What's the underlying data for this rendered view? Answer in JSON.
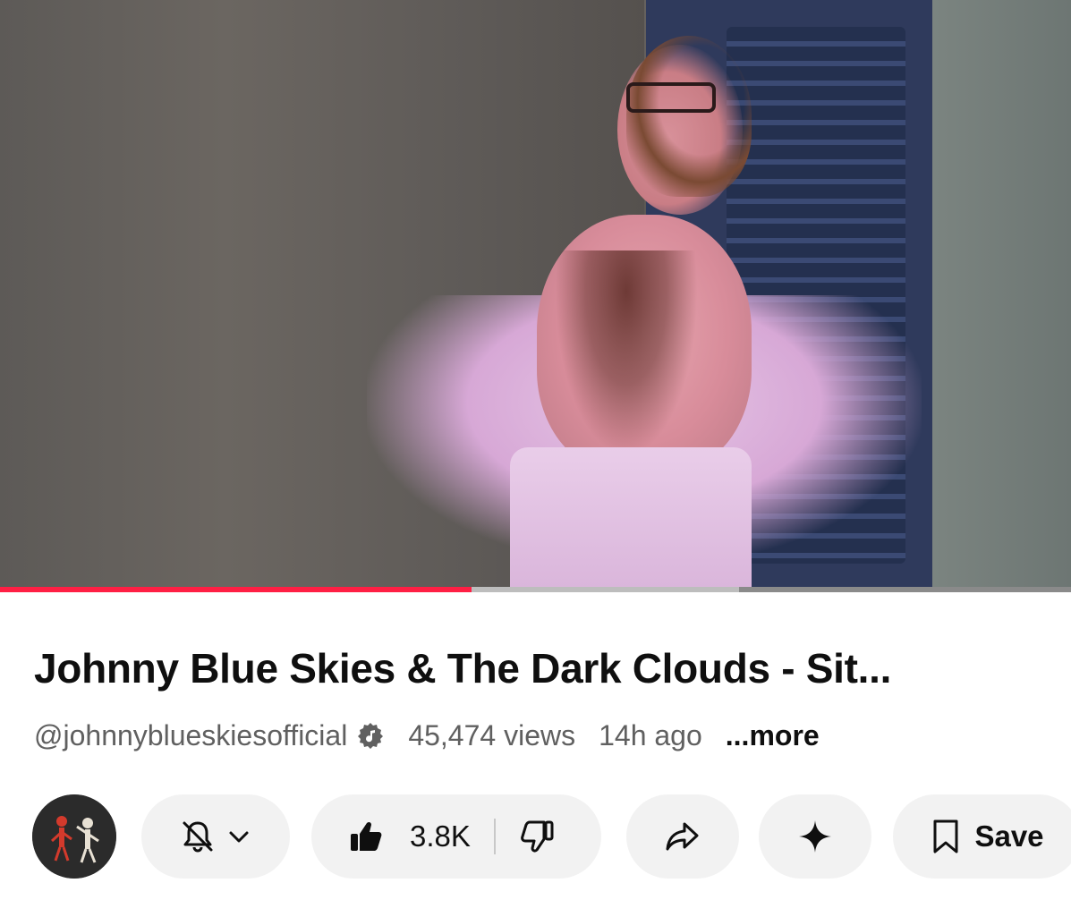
{
  "player": {
    "progress_played_fraction": 0.44,
    "progress_buffered_fraction": 0.69,
    "accent_color": "#ff1f44"
  },
  "video": {
    "title": "Johnny Blue Skies & The Dark Clouds - Sit...",
    "channel_handle": "@johnnyblueskiesofficial",
    "verified_icon": "music-note-verified-icon",
    "views": "45,474 views",
    "age": "14h ago",
    "more_label": "...more"
  },
  "actions": {
    "avatar_icon": "skeleton-duo-avatar",
    "subscribe_icons": [
      "bell-off-icon",
      "chevron-down-icon"
    ],
    "like_count": "3.8K",
    "like_icon": "thumbs-up-filled-icon",
    "dislike_icon": "thumbs-down-icon",
    "share_icon": "share-arrow-icon",
    "ai_icon": "sparkle-icon",
    "save_icon": "bookmark-icon",
    "save_label": "Save"
  }
}
